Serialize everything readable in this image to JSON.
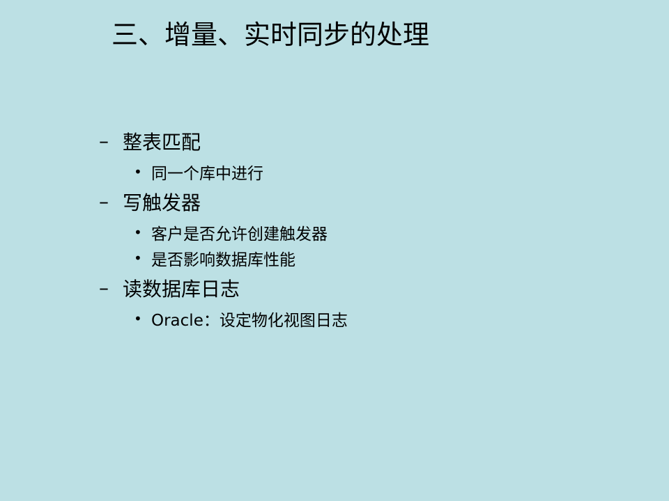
{
  "slide": {
    "title": "三、增量、实时同步的处理",
    "background_color": "#bce0e4",
    "sections": [
      {
        "marker": "–",
        "heading": "整表匹配",
        "items": [
          {
            "marker": "•",
            "text": "同一个库中进行"
          }
        ]
      },
      {
        "marker": "–",
        "heading": "写触发器",
        "items": [
          {
            "marker": "•",
            "text": "客户是否允许创建触发器"
          },
          {
            "marker": "•",
            "text": "是否影响数据库性能"
          }
        ]
      },
      {
        "marker": "–",
        "heading": "读数据库日志",
        "items": [
          {
            "marker": "•",
            "text": "Oracle：设定物化视图日志"
          }
        ]
      }
    ]
  }
}
